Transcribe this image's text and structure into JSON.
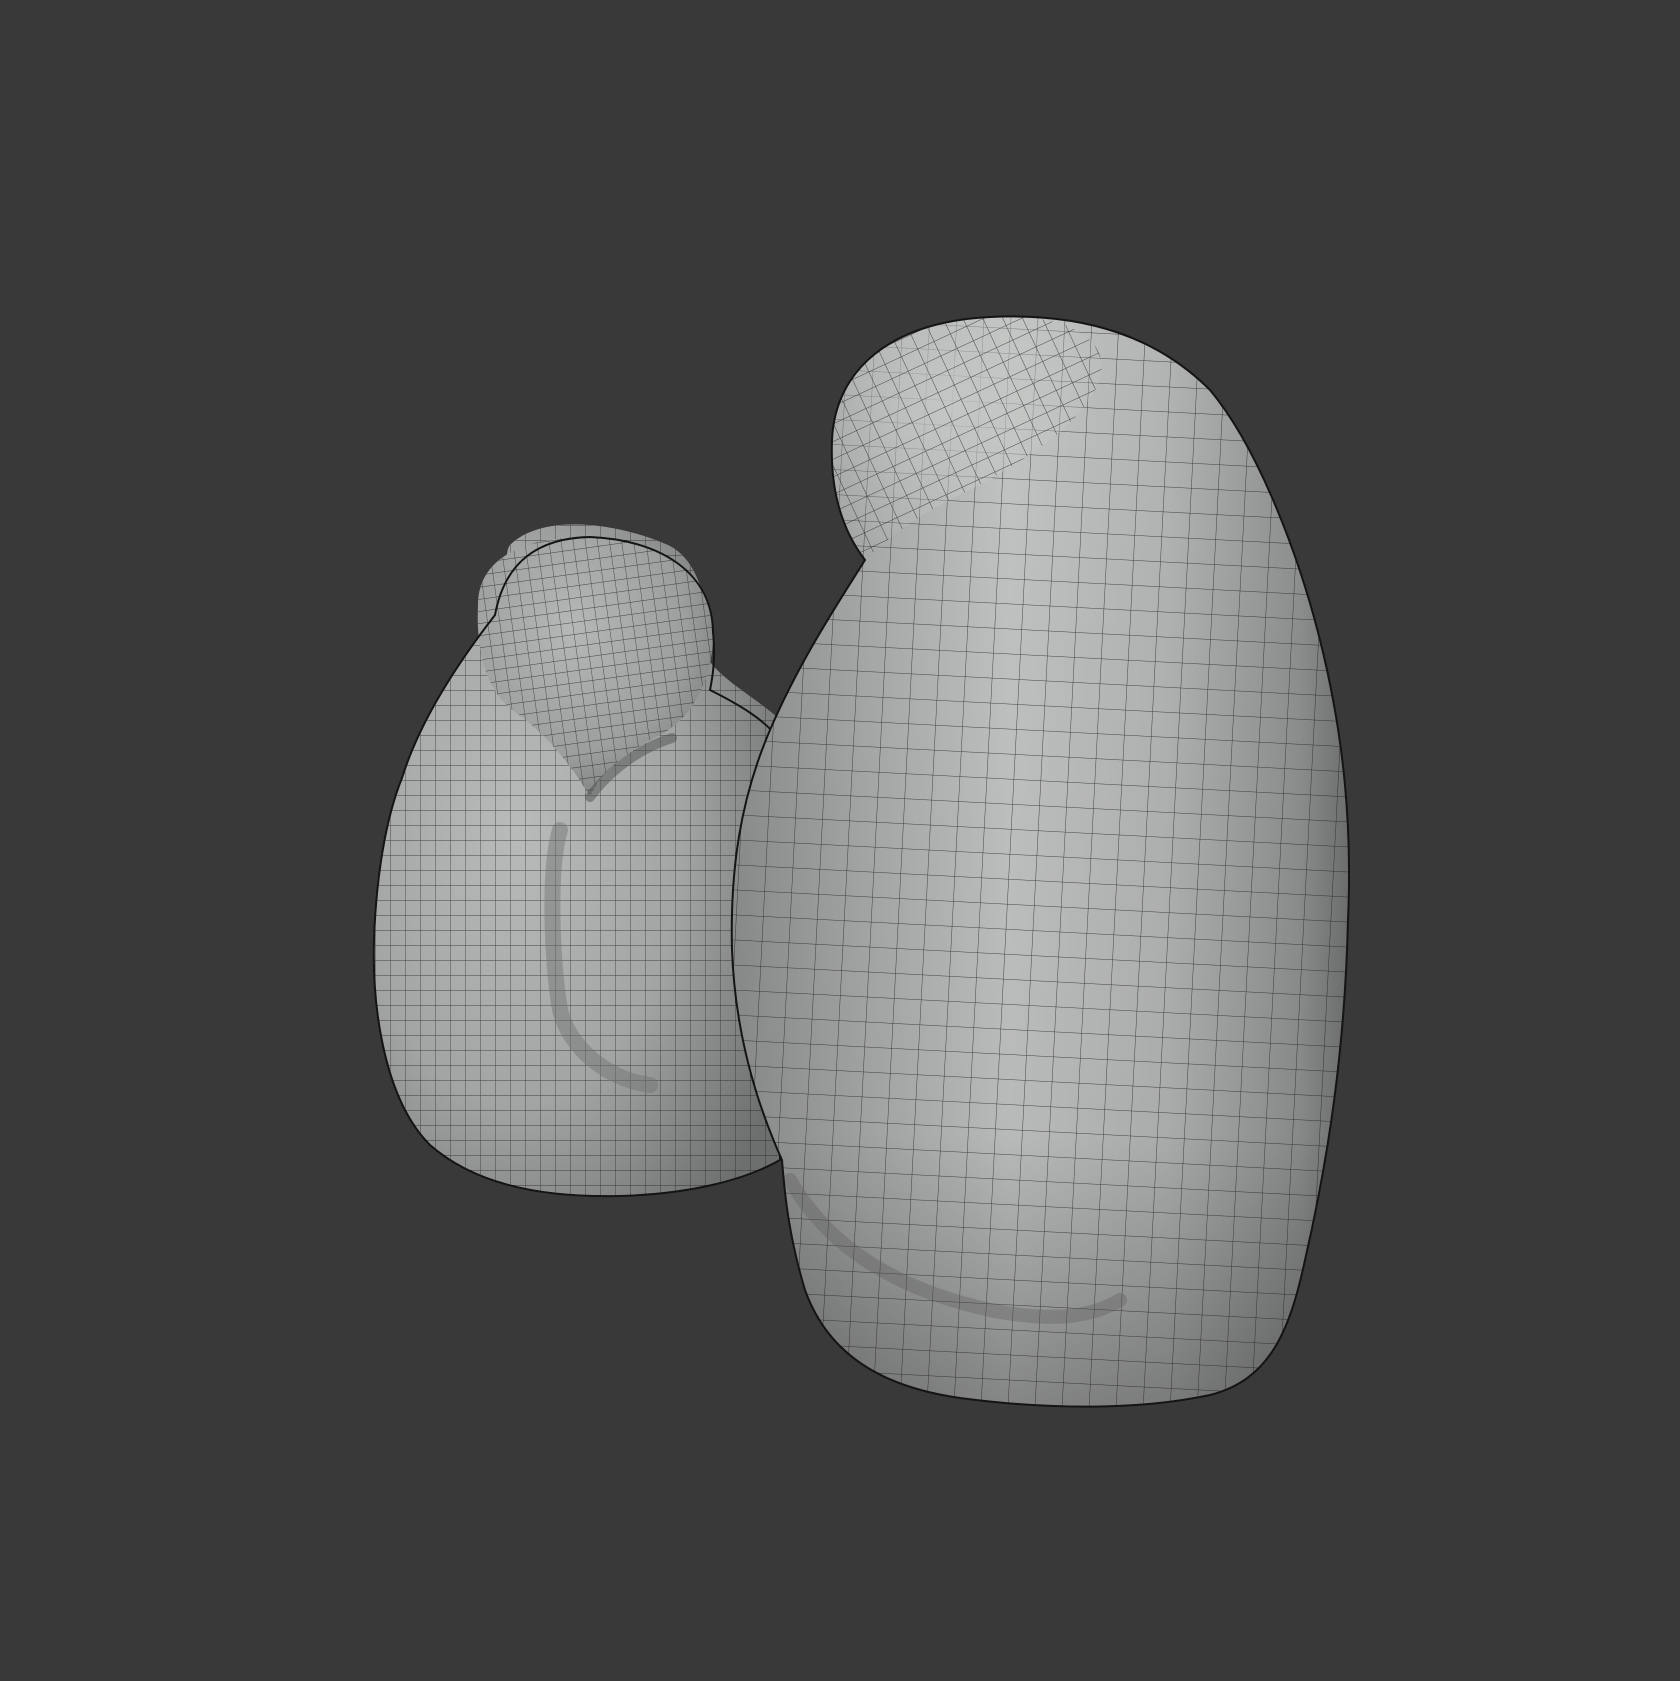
{
  "viewport": {
    "name": "3D Viewport",
    "background_color": "#393939",
    "wire_color": "#1a1a1a",
    "shading": "solid",
    "overlay": "wireframe"
  },
  "objects": [
    {
      "id": "small-blob",
      "kind": "subdivided mesh",
      "base_color": "#a8aaa9"
    },
    {
      "id": "large-blob",
      "kind": "subdivided mesh",
      "base_color": "#b4b6b5"
    }
  ]
}
